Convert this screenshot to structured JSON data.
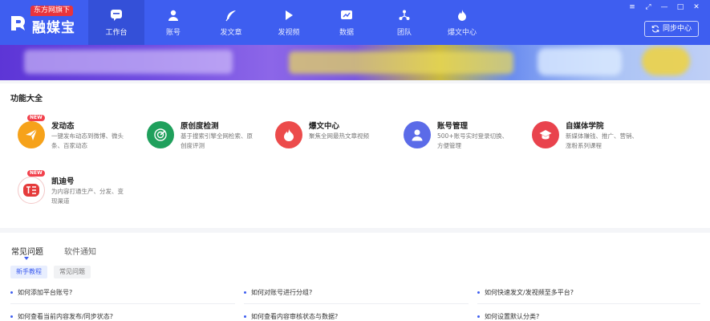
{
  "app": {
    "badge": "东方网旗下",
    "name": "融媒宝"
  },
  "nav": [
    {
      "label": "工作台",
      "icon": "chat-bubble-icon"
    },
    {
      "label": "账号",
      "icon": "user-icon"
    },
    {
      "label": "发文章",
      "icon": "feather-icon"
    },
    {
      "label": "发视频",
      "icon": "play-icon"
    },
    {
      "label": "数据",
      "icon": "chart-icon"
    },
    {
      "label": "团队",
      "icon": "team-icon"
    },
    {
      "label": "爆文中心",
      "icon": "flame-icon"
    }
  ],
  "window_controls": [
    "≡",
    "⤢",
    "—",
    "□",
    "✕"
  ],
  "sync_button": "同步中心",
  "features": {
    "title": "功能大全",
    "new_tag": "NEW",
    "items": [
      {
        "title": "发动态",
        "desc": "一键发布动态到微博、微头条、百家动态",
        "color": "#f6a21a",
        "icon": "paper-plane-icon",
        "is_new": true
      },
      {
        "title": "原创度检测",
        "desc": "基于搜索引擎全网检索、原创度评测",
        "color": "#1fa05c",
        "icon": "radar-icon",
        "is_new": false
      },
      {
        "title": "爆文中心",
        "desc": "聚焦全网最热文章视频",
        "color": "#ec4b4b",
        "icon": "flame-icon",
        "is_new": false
      },
      {
        "title": "账号管理",
        "desc": "500+账号实时登录切换、方便管理",
        "color": "#5b6be8",
        "icon": "user-icon",
        "is_new": false
      },
      {
        "title": "自媒体学院",
        "desc": "新媒体赚钱、推广、营销、涨粉系列课程",
        "color": "#e9434d",
        "icon": "graduation-cap-icon",
        "is_new": false
      },
      {
        "title": "凯迪号",
        "desc": "为内容打通生产、分发、变现渠道",
        "color": "#e53b3b",
        "icon": "kaidi-logo-icon",
        "is_new": true
      }
    ]
  },
  "faq": {
    "tabs": [
      "常见问题",
      "软件通知"
    ],
    "pills": [
      "新手教程",
      "常见问题"
    ],
    "questions": [
      "如何添加平台账号?",
      "如何对账号进行分组?",
      "如何快速发文/发视频至多平台?",
      "如何查看当前内容发布/同步状态?",
      "如何查看内容审核状态与数据?",
      "如何设置默认分类?"
    ]
  }
}
